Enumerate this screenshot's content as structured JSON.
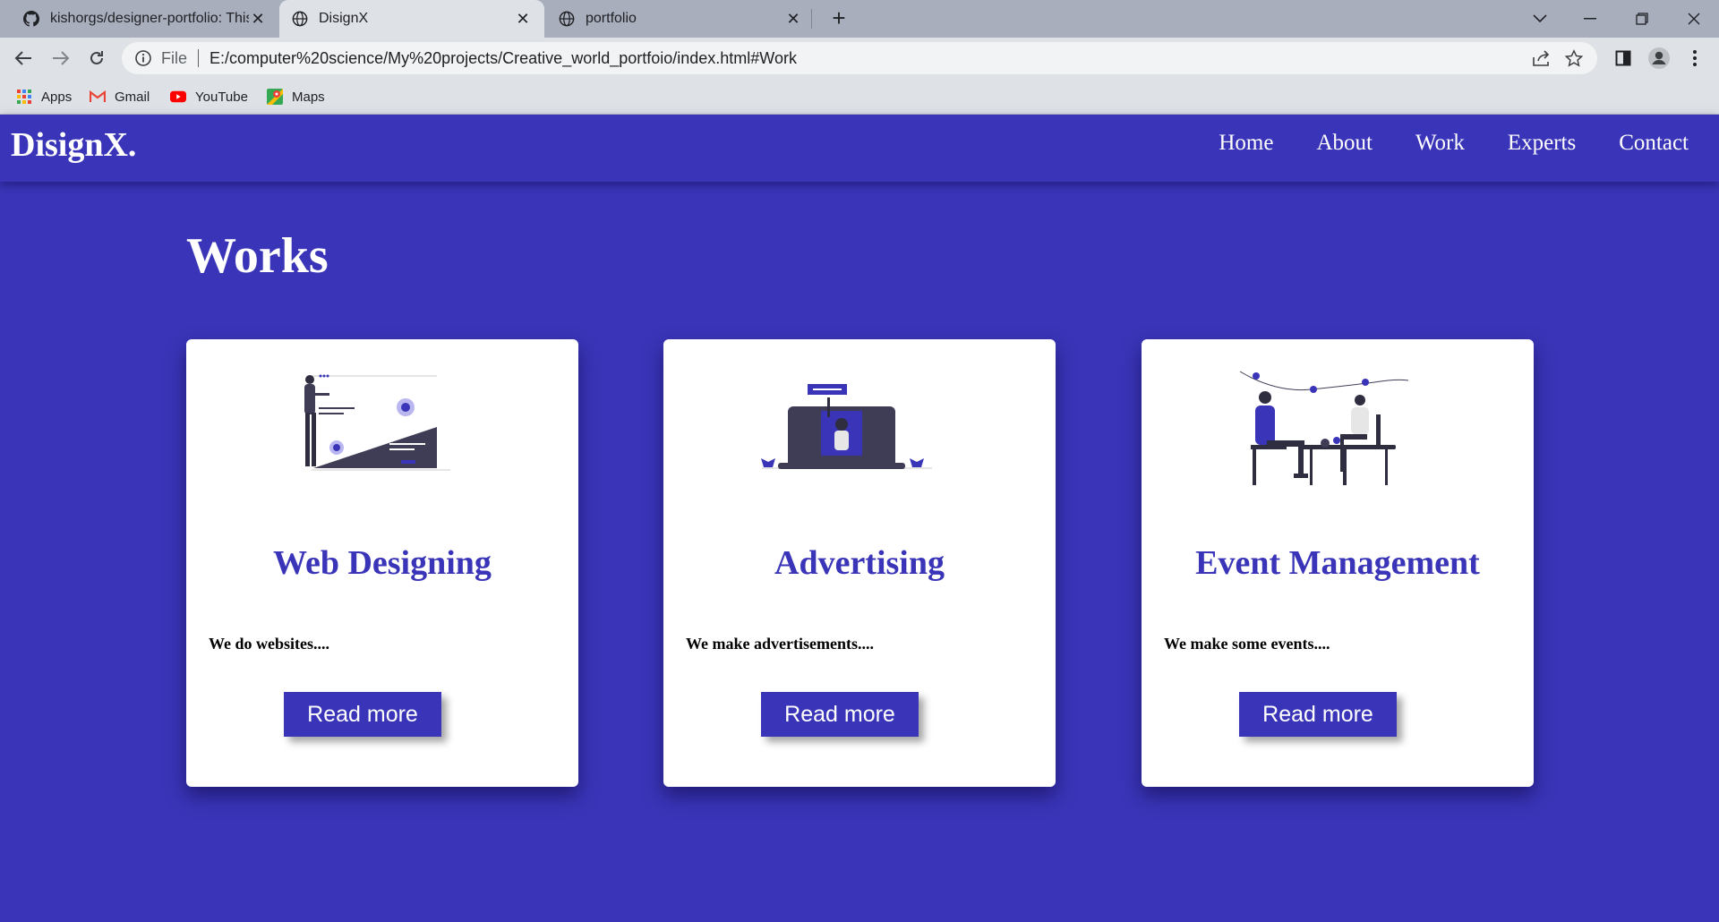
{
  "browser": {
    "tabs": [
      {
        "title": "kishorgs/designer-portfolio: This",
        "icon": "github-icon",
        "active": false
      },
      {
        "title": "DisignX",
        "icon": "globe-icon",
        "active": true
      },
      {
        "title": "portfolio",
        "icon": "globe-icon",
        "active": false
      }
    ],
    "address": {
      "scheme_label": "File",
      "url": "E:/computer%20science/My%20projects/Creative_world_portfoio/index.html#Work"
    },
    "bookmarks": [
      {
        "label": "Apps",
        "icon": "apps-grid-icon"
      },
      {
        "label": "Gmail",
        "icon": "gmail-icon"
      },
      {
        "label": "YouTube",
        "icon": "youtube-icon"
      },
      {
        "label": "Maps",
        "icon": "maps-icon"
      }
    ]
  },
  "site": {
    "logo": "DisignX.",
    "nav": [
      "Home",
      "About",
      "Work",
      "Experts",
      "Contact"
    ],
    "section_title": "Works",
    "accent_color": "#3a35b8",
    "cards": [
      {
        "title": "Web Designing",
        "text": "We do websites....",
        "button": "Read more",
        "illustration": "web-design-illustration"
      },
      {
        "title": "Advertising",
        "text": "We make advertisements....",
        "button": "Read more",
        "illustration": "advertising-illustration"
      },
      {
        "title": "Event Management",
        "text": "We make some events....",
        "button": "Read more",
        "illustration": "event-illustration"
      }
    ]
  }
}
